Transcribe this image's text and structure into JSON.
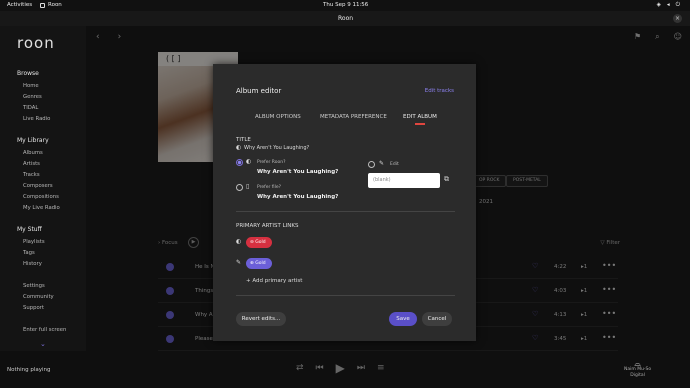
{
  "system": {
    "activities": "Activities",
    "app_name": "Roon",
    "clock": "Thu Sep 9  11:56"
  },
  "window": {
    "title": "Roon",
    "close": "×"
  },
  "sidebar": {
    "logo": "roon",
    "browse_heading": "Browse",
    "browse_items": [
      "Home",
      "Genres",
      "TIDAL",
      "Live Radio"
    ],
    "library_heading": "My Library",
    "library_items": [
      "Albums",
      "Artists",
      "Tracks",
      "Composers",
      "Compositions",
      "My Live Radio"
    ],
    "stuff_heading": "My Stuff",
    "stuff_items": [
      "Playlists",
      "Tags",
      "History"
    ],
    "settings_items": [
      "Settings",
      "Community",
      "Support"
    ],
    "fullscreen": "Enter full screen"
  },
  "album": {
    "cover_text": "( [  ]",
    "genres": [
      "OP ROCK",
      "POST-METAL"
    ],
    "year": "2021",
    "focus_label": "Focus",
    "filter_label": "Filter"
  },
  "tracks": [
    {
      "name": "He Is N",
      "duration": "4:22",
      "count": "1"
    },
    {
      "name": "Things I",
      "duration": "4:03",
      "count": "1"
    },
    {
      "name": "Why Ar",
      "duration": "4:13",
      "count": "1"
    },
    {
      "name": "Please T",
      "duration": "3:45",
      "count": "1"
    }
  ],
  "modal": {
    "title": "Album editor",
    "edit_tracks": "Edit tracks",
    "tabs": [
      "ALBUM OPTIONS",
      "METADATA PREFERENCE",
      "EDIT ALBUM"
    ],
    "active_tab": "EDIT ALBUM",
    "title_section": "TITLE",
    "current_title": "Why Aren't You Laughing?",
    "prefer_roon_label": "Prefer Roon?",
    "prefer_roon_value": "Why Aren't You Laughing?",
    "prefer_file_label": "Prefer file?",
    "prefer_file_value": "Why Aren't You Laughing?",
    "edit_label": "Edit",
    "edit_placeholder": "(blank)",
    "artist_section": "PRIMARY ARTIST LINKS",
    "artist_roon": "Gold",
    "artist_edit": "Gold",
    "add_artist": "Add primary artist",
    "revert": "Revert edits...",
    "save": "Save",
    "cancel": "Cancel"
  },
  "player": {
    "now_playing": "Nothing playing",
    "zone_line1": "Naim Mu-So",
    "zone_line2": "Digital"
  },
  "colors": {
    "accent": "#6b5fd8",
    "red": "#d63040"
  }
}
